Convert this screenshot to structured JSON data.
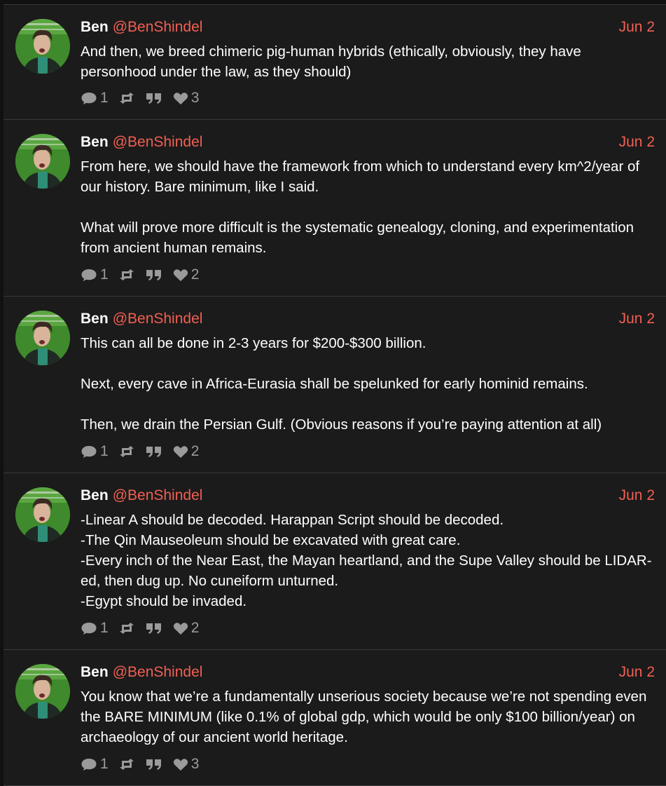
{
  "feed": {
    "posts": [
      {
        "author_name": "Ben",
        "author_handle": "@BenShindel",
        "date": "Jun 2",
        "paragraphs": [
          "And then, we breed chimeric pig-human hybrids (ethically, obviously, they have personhood under the law, as they should)"
        ],
        "replies": "1",
        "likes": "3"
      },
      {
        "author_name": "Ben",
        "author_handle": "@BenShindel",
        "date": "Jun 2",
        "paragraphs": [
          "From here, we should have the framework from which to understand every km^2/year of our history.  Bare minimum, like I said.",
          "What will prove more difficult is the systematic genealogy, cloning, and experimentation from ancient human remains."
        ],
        "replies": "1",
        "likes": "2"
      },
      {
        "author_name": "Ben",
        "author_handle": "@BenShindel",
        "date": "Jun 2",
        "paragraphs": [
          "This can all be done in 2-3 years for $200-$300 billion.",
          "Next, every cave in Africa-Eurasia shall be spelunked for early hominid remains.",
          "Then, we drain the Persian Gulf.  (Obvious reasons if you’re paying attention at all)"
        ],
        "replies": "1",
        "likes": "2"
      },
      {
        "author_name": "Ben",
        "author_handle": "@BenShindel",
        "date": "Jun 2",
        "paragraphs": [
          "-Linear A should be decoded.  Harappan Script should be decoded.\n-The Qin Mauseoleum should be excavated with great care.\n-Every inch of the Near East, the Mayan heartland, and the Supe Valley should be LIDAR-ed, then dug up.  No cuneiform unturned.\n-Egypt should be invaded."
        ],
        "replies": "1",
        "likes": "2"
      },
      {
        "author_name": "Ben",
        "author_handle": "@BenShindel",
        "date": "Jun 2",
        "paragraphs": [
          "You know that we’re a fundamentally unserious society because we’re not spending even the BARE MINIMUM (like 0.1% of global gdp, which would be only $100 billion/year) on archaeology of our ancient world heritage."
        ],
        "replies": "1",
        "likes": "3"
      }
    ]
  },
  "theme": {
    "background": "#1b1b1b",
    "accent": "#f25f52",
    "text": "#ffffff",
    "muted": "#9a9a9a"
  },
  "icons": {
    "reply": "comment-icon",
    "repost": "repost-icon",
    "quote": "quote-icon",
    "like": "heart-icon"
  }
}
